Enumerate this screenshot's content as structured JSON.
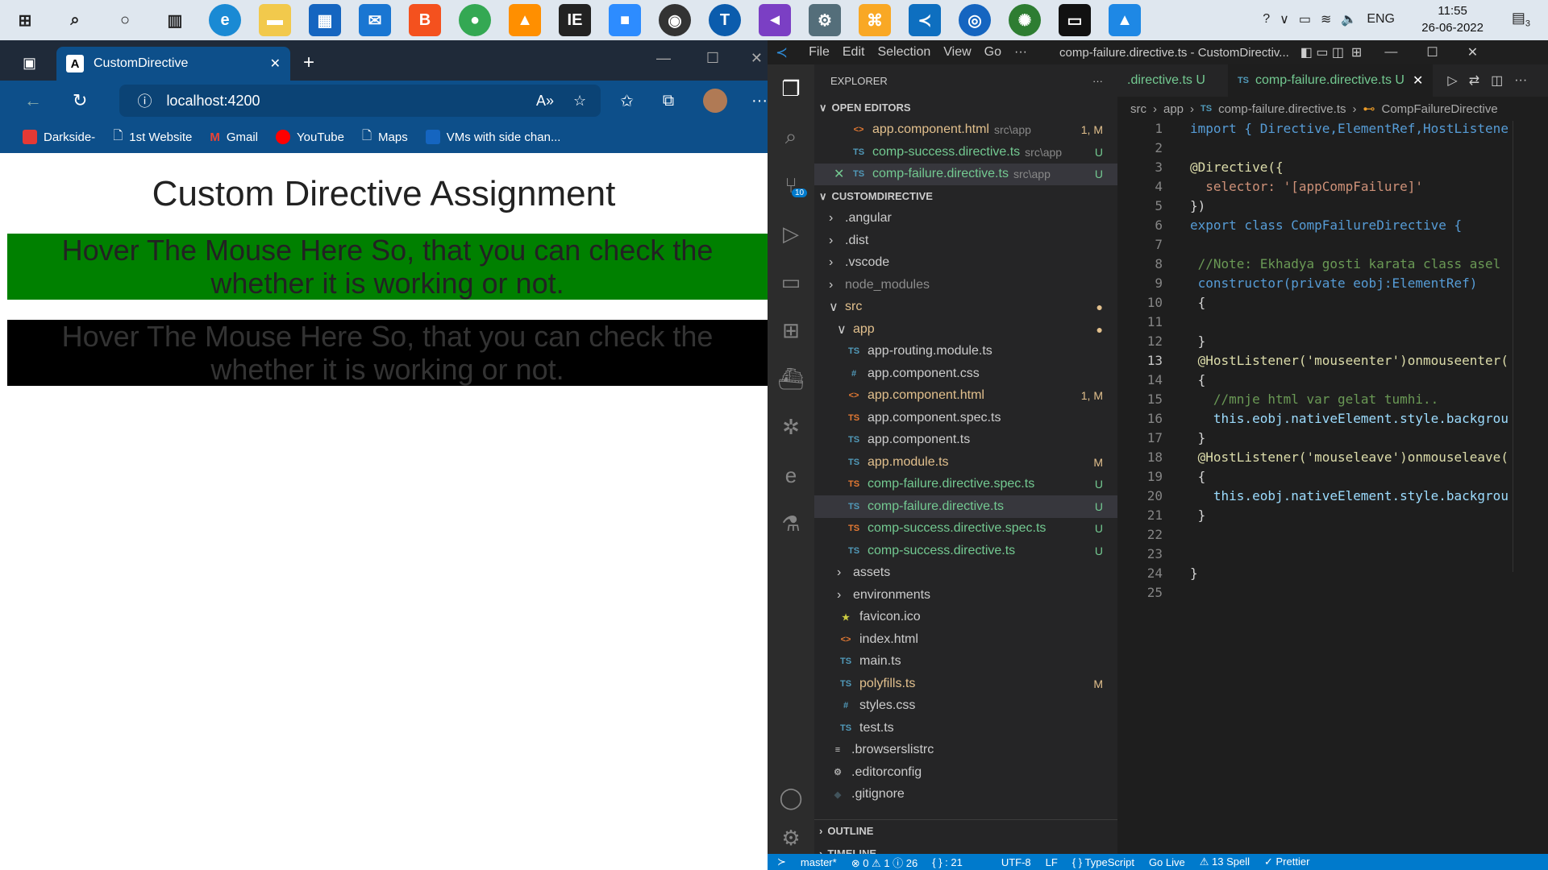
{
  "taskbar": {
    "clock_time": "11:55",
    "clock_date": "26-06-2022",
    "language": "ENG",
    "notifications": "3"
  },
  "browser": {
    "tab_title": "CustomDirective",
    "address": "localhost:4200",
    "favorites": [
      "Darkside-",
      "1st Website",
      "Gmail",
      "YouTube",
      "Maps",
      "VMs with side chan..."
    ]
  },
  "page": {
    "heading": "Custom Directive Assignment",
    "box_text": "Hover The Mouse Here So, that you can check the whether it is working or not.",
    "box1_color": "#008000",
    "box2_color": "#000000"
  },
  "vscode": {
    "menu": [
      "File",
      "Edit",
      "Selection",
      "View",
      "Go",
      "···"
    ],
    "window_title": "comp-failure.directive.ts - CustomDirectiv...",
    "explorer_title": "EXPLORER",
    "open_editors_label": "OPEN EDITORS",
    "open_editors": [
      {
        "icon": "<>",
        "name": "app.component.html",
        "path": "src\\app",
        "badge": "1, M",
        "color": "#e2c08d"
      },
      {
        "icon": "TS",
        "name": "comp-success.directive.ts",
        "path": "src\\app",
        "badge": "U",
        "color": "#73c991"
      },
      {
        "icon": "TS",
        "name": "comp-failure.directive.ts",
        "path": "src\\app",
        "badge": "U",
        "color": "#73c991"
      }
    ],
    "project_label": "CUSTOMDIRECTIVE",
    "tree": [
      {
        "indent": 0,
        "chev": ">",
        "icon": "",
        "name": ".angular",
        "badge": "",
        "color": "#ccc"
      },
      {
        "indent": 0,
        "chev": ">",
        "icon": "",
        "name": ".dist",
        "badge": "",
        "color": "#ccc"
      },
      {
        "indent": 0,
        "chev": ">",
        "icon": "",
        "name": ".vscode",
        "badge": "",
        "color": "#ccc"
      },
      {
        "indent": 0,
        "chev": ">",
        "icon": "",
        "name": "node_modules",
        "badge": "",
        "color": "#8c8c8c"
      },
      {
        "indent": 0,
        "chev": "v",
        "icon": "",
        "name": "src",
        "badge": "●",
        "color": "#e2c08d"
      },
      {
        "indent": 1,
        "chev": "v",
        "icon": "",
        "name": "app",
        "badge": "●",
        "color": "#e2c08d"
      },
      {
        "indent": 2,
        "chev": "",
        "icon": "TS",
        "name": "app-routing.module.ts",
        "badge": "",
        "color": "#ccc"
      },
      {
        "indent": 2,
        "chev": "",
        "icon": "#",
        "name": "app.component.css",
        "badge": "",
        "color": "#ccc"
      },
      {
        "indent": 2,
        "chev": "",
        "icon": "<>",
        "name": "app.component.html",
        "badge": "1, M",
        "color": "#e2c08d"
      },
      {
        "indent": 2,
        "chev": "",
        "icon": "TS",
        "name": "app.component.spec.ts",
        "badge": "",
        "color": "#ccc"
      },
      {
        "indent": 2,
        "chev": "",
        "icon": "TS",
        "name": "app.component.ts",
        "badge": "",
        "color": "#ccc"
      },
      {
        "indent": 2,
        "chev": "",
        "icon": "TS",
        "name": "app.module.ts",
        "badge": "M",
        "color": "#e2c08d"
      },
      {
        "indent": 2,
        "chev": "",
        "icon": "TS",
        "name": "comp-failure.directive.spec.ts",
        "badge": "U",
        "color": "#73c991"
      },
      {
        "indent": 2,
        "chev": "",
        "icon": "TS",
        "name": "comp-failure.directive.ts",
        "badge": "U",
        "color": "#73c991"
      },
      {
        "indent": 2,
        "chev": "",
        "icon": "TS",
        "name": "comp-success.directive.spec.ts",
        "badge": "U",
        "color": "#73c991"
      },
      {
        "indent": 2,
        "chev": "",
        "icon": "TS",
        "name": "comp-success.directive.ts",
        "badge": "U",
        "color": "#73c991"
      },
      {
        "indent": 1,
        "chev": ">",
        "icon": "",
        "name": "assets",
        "badge": "",
        "color": "#ccc"
      },
      {
        "indent": 1,
        "chev": ">",
        "icon": "",
        "name": "environments",
        "badge": "",
        "color": "#ccc"
      },
      {
        "indent": 1,
        "chev": "",
        "icon": "★",
        "name": "favicon.ico",
        "badge": "",
        "color": "#ccc"
      },
      {
        "indent": 1,
        "chev": "",
        "icon": "<>",
        "name": "index.html",
        "badge": "",
        "color": "#ccc"
      },
      {
        "indent": 1,
        "chev": "",
        "icon": "TS",
        "name": "main.ts",
        "badge": "",
        "color": "#ccc"
      },
      {
        "indent": 1,
        "chev": "",
        "icon": "TS",
        "name": "polyfills.ts",
        "badge": "M",
        "color": "#e2c08d"
      },
      {
        "indent": 1,
        "chev": "",
        "icon": "#",
        "name": "styles.css",
        "badge": "",
        "color": "#ccc"
      },
      {
        "indent": 1,
        "chev": "",
        "icon": "TS",
        "name": "test.ts",
        "badge": "",
        "color": "#ccc"
      },
      {
        "indent": 0,
        "chev": "",
        "icon": "≡",
        "name": ".browserslistrc",
        "badge": "",
        "color": "#ccc"
      },
      {
        "indent": 0,
        "chev": "",
        "icon": "⚙",
        "name": ".editorconfig",
        "badge": "",
        "color": "#ccc"
      },
      {
        "indent": 0,
        "chev": "",
        "icon": "◆",
        "name": ".gitignore",
        "badge": "",
        "color": "#ccc"
      }
    ],
    "outline_label": "OUTLINE",
    "timeline_label": "TIMELINE",
    "tabs": [
      {
        "name": ".directive.ts",
        "badge": "U",
        "active": false
      },
      {
        "name": "comp-failure.directive.ts",
        "badge": "U",
        "active": true
      }
    ],
    "breadcrumb": [
      "src",
      "app",
      "comp-failure.directive.ts",
      "CompFailureDirective"
    ],
    "code": [
      "import { Directive,ElementRef,HostListene",
      "",
      "@Directive({",
      "  selector: '[appCompFailure]'",
      "})",
      "export class CompFailureDirective {",
      "",
      " //Note: Ekhadya gosti karata class asel",
      " constructor(private eobj:ElementRef)",
      " {",
      "",
      " }",
      " @HostListener('mouseenter')onmouseenter(",
      " {",
      "   //mnje html var gelat tumhi..",
      "   this.eobj.nativeElement.style.backgrou",
      " }",
      " @HostListener('mouseleave')onmouseleave(",
      " {",
      "   this.eobj.nativeElement.style.backgrou",
      " }",
      "",
      "",
      "}",
      ""
    ],
    "status": [
      "master*",
      "⊗ 0  ⚠ 1  ⓘ 26",
      "{ } : 21",
      "UTF-8",
      "LF",
      "{ } TypeScript",
      "Go Live",
      "⚠ 13 Spell",
      "✓ Prettier"
    ],
    "scm_badge": "10"
  }
}
